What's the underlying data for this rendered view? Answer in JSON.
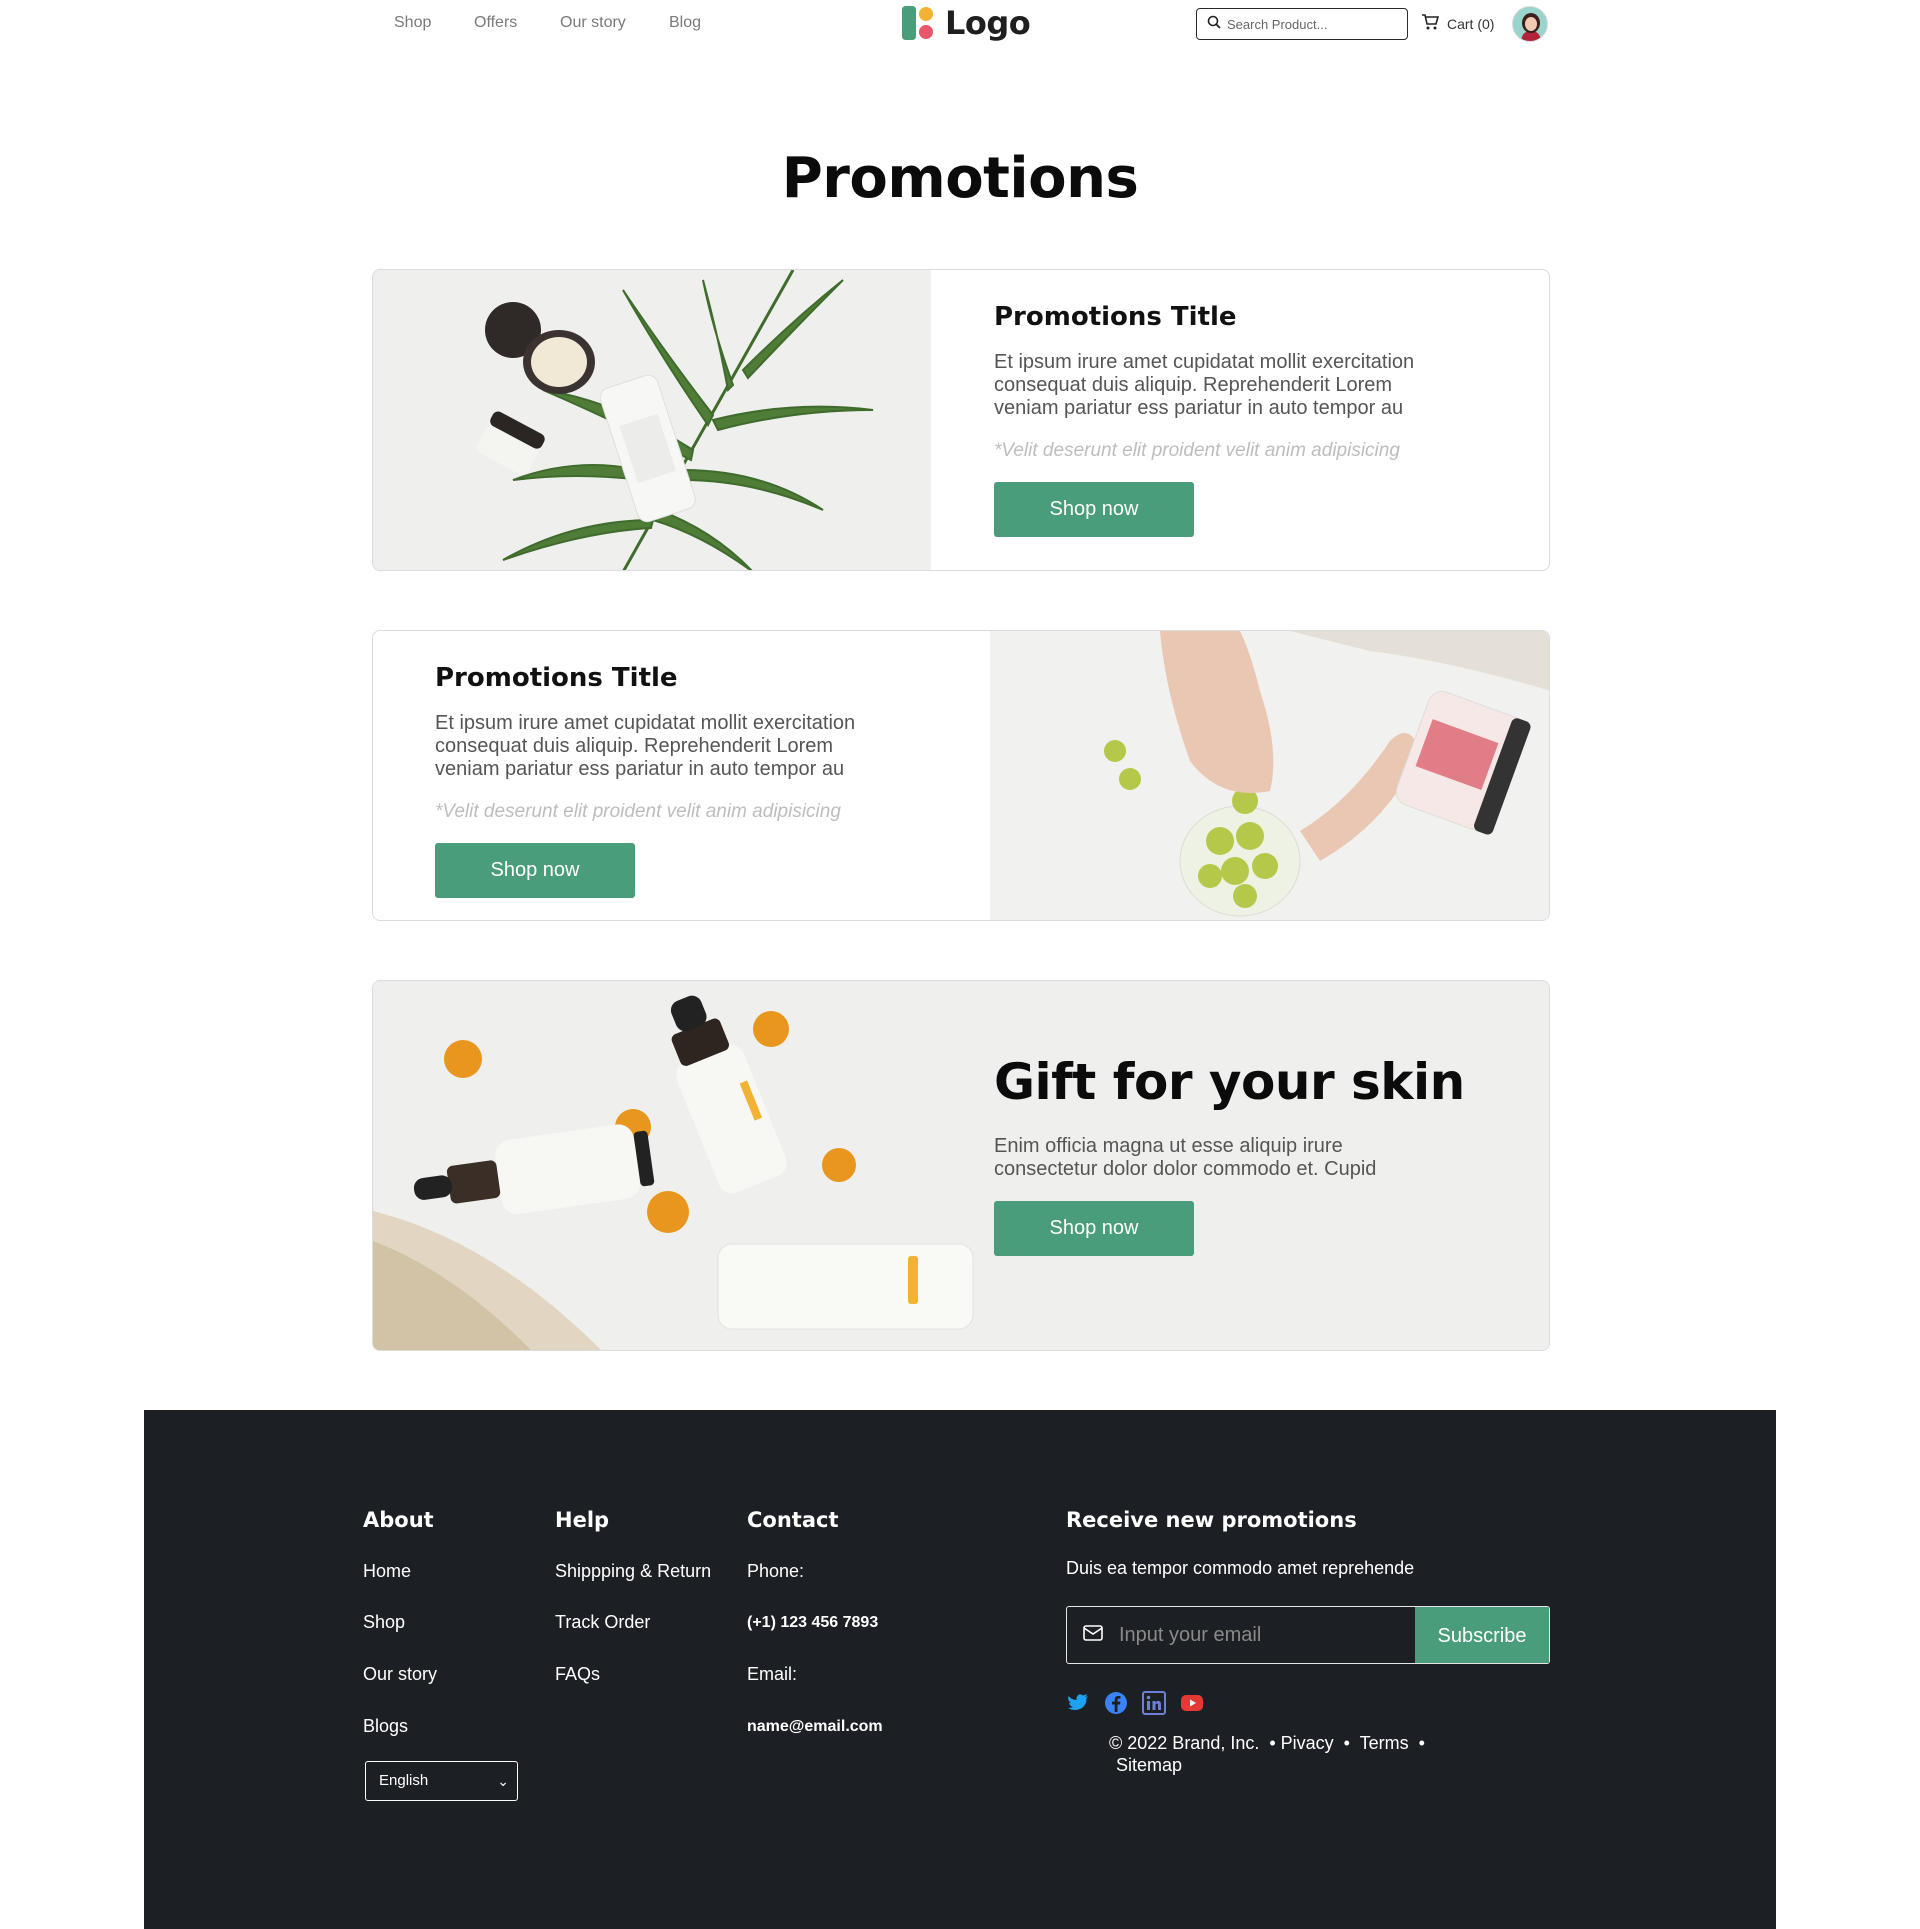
{
  "header": {
    "nav": [
      "Shop",
      "Offers",
      "Our story",
      "Blog"
    ],
    "logo_text": "Logo",
    "search_placeholder": "Search Product...",
    "cart_label": "Cart (0)"
  },
  "page_title": "Promotions",
  "promotions": [
    {
      "title": "Promotions Title",
      "description": "Et ipsum irure amet cupidatat mollit exercitation consequat duis aliquip. Reprehenderit Lorem veniam pariatur ess pariatur in auto tempor au",
      "note": "*Velit deserunt elit proident velit anim adipisicing",
      "button": "Shop now"
    },
    {
      "title": "Promotions Title",
      "description": "Et ipsum irure amet cupidatat mollit exercitation consequat duis aliquip. Reprehenderit Lorem veniam pariatur ess pariatur in auto tempor au",
      "note": "*Velit deserunt elit proident velit anim adipisicing",
      "button": "Shop now"
    }
  ],
  "banner": {
    "title": "Gift for your skin",
    "description": "Enim officia magna ut esse aliquip irure consectetur dolor dolor commodo et. Cupid",
    "button": "Shop now"
  },
  "footer": {
    "about": {
      "heading": "About",
      "links": [
        "Home",
        "Shop",
        "Our story",
        "Blogs"
      ]
    },
    "help": {
      "heading": "Help",
      "links": [
        "Shippping & Return",
        "Track Order",
        "FAQs"
      ]
    },
    "contact": {
      "heading": "Contact",
      "phone_label": "Phone:",
      "phone": "(+1) 123 456 7893",
      "email_label": "Email:",
      "email": "name@email.com"
    },
    "newsletter": {
      "heading": "Receive new promotions",
      "text": "Duis ea tempor commodo amet reprehende",
      "placeholder": "Input your email",
      "button": "Subscribe"
    },
    "language": "English",
    "legal_line1": "© 2022 Brand, Inc.  • Pivacy  •  Terms  •",
    "legal_line2": "Sitemap",
    "social_icons": [
      "twitter-icon",
      "facebook-icon",
      "linkedin-icon",
      "youtube-icon"
    ]
  },
  "colors": {
    "accent": "#4a9d7a",
    "footer_bg": "#1c1f24",
    "logo_green": "#4a9d7a",
    "logo_yellow": "#f2b233",
    "logo_pink": "#e8576a",
    "twitter": "#1da1f2",
    "facebook": "#3b82f6",
    "linkedin": "#6d7fd6",
    "youtube": "#e53935"
  }
}
